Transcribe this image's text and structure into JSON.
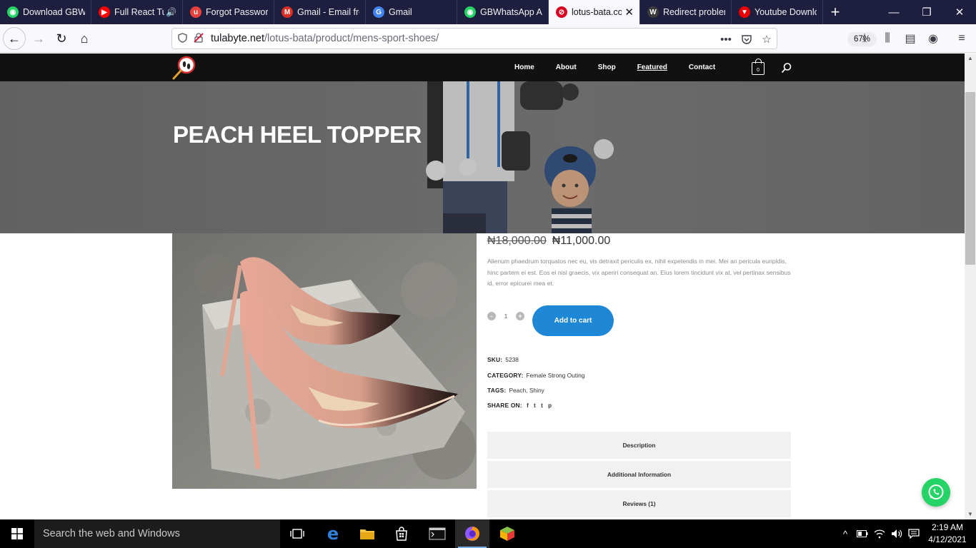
{
  "browser": {
    "tabs": [
      {
        "title": "Download GBWhatsApp",
        "favicon_color": "#25d366",
        "favicon_glyph": "◉",
        "audio": false
      },
      {
        "title": "Full React Tutorial",
        "favicon_color": "#ff0000",
        "favicon_glyph": "▶",
        "audio": true
      },
      {
        "title": "Forgot Password",
        "favicon_color": "#e8413c",
        "favicon_glyph": "u",
        "audio": false
      },
      {
        "title": "Gmail - Email from",
        "favicon_color": "#d93025",
        "favicon_glyph": "M",
        "audio": false
      },
      {
        "title": "Gmail",
        "favicon_color": "#4285f4",
        "favicon_glyph": "G",
        "audio": false
      },
      {
        "title": "GBWhatsApp APK",
        "favicon_color": "#25d366",
        "favicon_glyph": "◉",
        "audio": false
      },
      {
        "title": "lotus-bata.com",
        "favicon_color": "#d70022",
        "favicon_glyph": "⊘",
        "audio": false,
        "active": true
      },
      {
        "title": "Redirect problem",
        "favicon_color": "#3b3b3b",
        "favicon_glyph": "W",
        "audio": false
      },
      {
        "title": "Youtube Downloader",
        "favicon_color": "#e00",
        "favicon_glyph": "▼",
        "audio": false
      }
    ],
    "new_tab_glyph": "+",
    "window_controls": {
      "minimize": "—",
      "restore": "❐",
      "close": "✕"
    },
    "nav": {
      "back": "←",
      "forward": "→",
      "reload": "↻",
      "home": "⌂"
    },
    "url": {
      "host": "tulabyte.net",
      "path": "/lotus-bata/product/mens-sport-shoes/"
    },
    "zoom": "67%",
    "url_icons": {
      "more": "•••",
      "pocket": "♡",
      "bookmark": "☆"
    },
    "toolbar_icons": {
      "downloads": "⤓",
      "library": "⫼",
      "sidebar": "▤",
      "account": "◉",
      "menu": "≡"
    }
  },
  "site": {
    "menu": [
      {
        "label": "Home",
        "current": false
      },
      {
        "label": "About",
        "current": false
      },
      {
        "label": "Shop",
        "current": false
      },
      {
        "label": "Featured",
        "current": true
      },
      {
        "label": "Contact",
        "current": false
      }
    ],
    "cart_count": "0"
  },
  "product": {
    "title": "PEACH HEEL TOPPER",
    "old_price": "₦18,000.00",
    "price": "₦11,000.00",
    "description": "Alienum phaedrum torquatos nec eu, vis detraxit periculis ex, nihil expetendis in mei. Mei an pericula euripidis, hinc partem ei est. Eos ei nisl graecis, vix aperiri consequat an. Eius lorem tincidunt vix at, vel pertinax sensibus id, error epicurei mea et.",
    "quantity": "1",
    "qty_minus": "-",
    "qty_plus": "+",
    "add_to_cart": "Add to cart",
    "sku_label": "SKU:",
    "sku": "5238",
    "category_label": "CATEGORY:",
    "category": "Female Strong Outing",
    "tags_label": "TAGS:",
    "tags": "Peach, Shiny",
    "share_label": "SHARE ON:",
    "share_icons": [
      "f",
      "t",
      "t",
      "p"
    ],
    "tabs": [
      "Description",
      "Additional Information",
      "Reviews (1)"
    ]
  },
  "taskbar": {
    "search_placeholder": "Search the web and Windows",
    "time": "2:19 AM",
    "date": "4/12/2021"
  }
}
